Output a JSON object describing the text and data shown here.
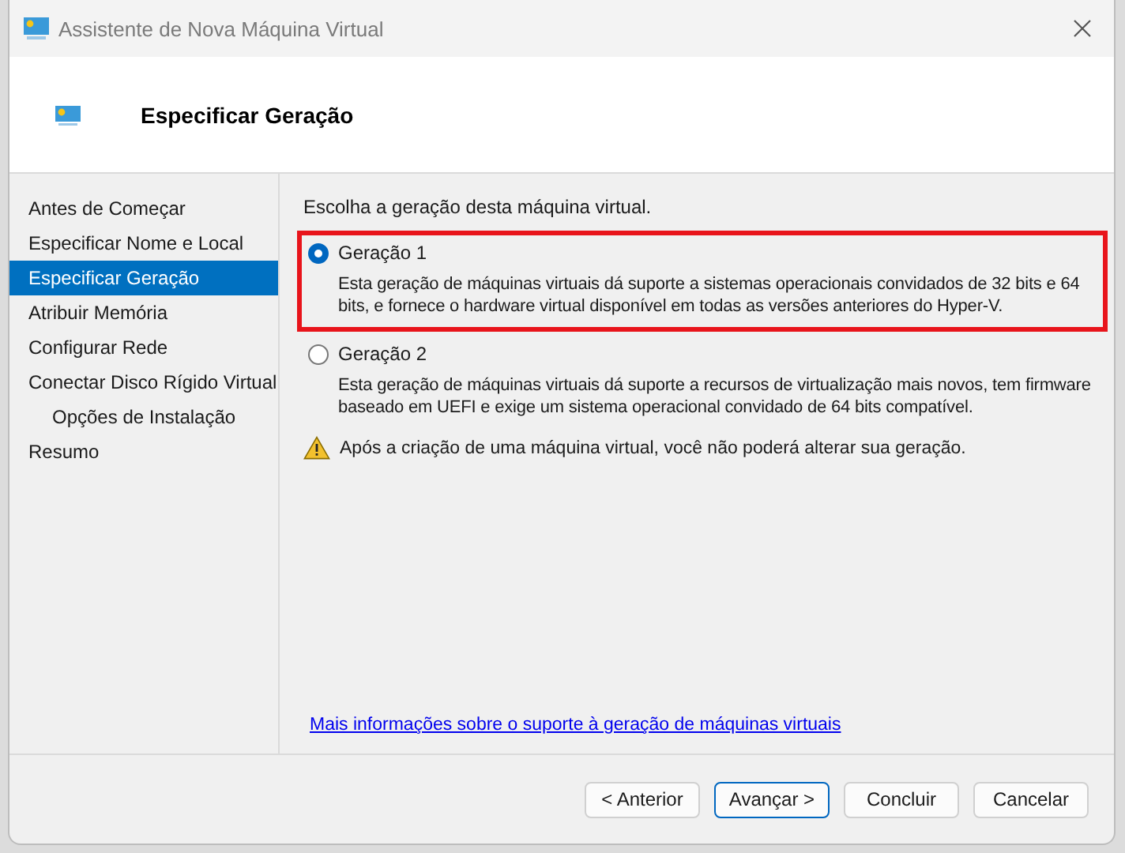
{
  "window": {
    "title": "Assistente de Nova Máquina Virtual"
  },
  "header": {
    "title": "Especificar Geração"
  },
  "steps": [
    {
      "label": "Antes de Começar",
      "selected": false
    },
    {
      "label": "Especificar Nome e Local",
      "selected": false
    },
    {
      "label": "Especificar Geração",
      "selected": true
    },
    {
      "label": "Atribuir Memória",
      "selected": false
    },
    {
      "label": "Configurar Rede",
      "selected": false
    },
    {
      "label": "Conectar Disco Rígido Virtual",
      "selected": false,
      "children": [
        {
          "label": "Opções de Instalação",
          "selected": false
        }
      ]
    },
    {
      "label": "Resumo",
      "selected": false
    }
  ],
  "prompt": "Escolha a geração desta máquina virtual.",
  "options": [
    {
      "label": "Geração 1",
      "selected": true,
      "highlighted": true,
      "description": "Esta geração de máquinas virtuais dá suporte a sistemas operacionais convidados de 32 bits e 64 bits, e fornece o hardware virtual disponível em todas as versões anteriores do Hyper-V."
    },
    {
      "label": "Geração 2",
      "selected": false,
      "highlighted": false,
      "description": "Esta geração de máquinas virtuais dá suporte a recursos de virtualização mais novos, tem firmware baseado em UEFI e exige um sistema operacional convidado de 64 bits compatível."
    }
  ],
  "warning": "Após a criação de uma máquina virtual, você não poderá alterar sua geração.",
  "link": "Mais informações sobre o suporte à geração de máquinas virtuais",
  "buttons": [
    {
      "label": "< Anterior",
      "default": false
    },
    {
      "label": "Avançar >",
      "default": true
    },
    {
      "label": "Concluir",
      "default": false
    },
    {
      "label": "Cancelar",
      "default": false
    }
  ]
}
